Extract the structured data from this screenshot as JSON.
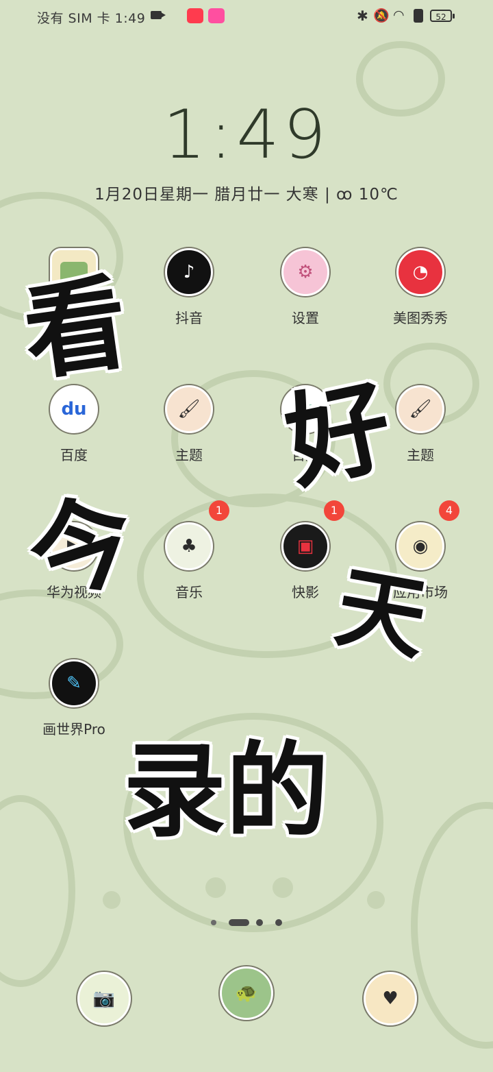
{
  "status_bar": {
    "carrier_time": "没有 SIM 卡 1:49",
    "battery_level": "52"
  },
  "lockscreen": {
    "time": "1:49",
    "date_line": "1月20日星期一  腊月廿一  大寒  |  ꝏ 10℃"
  },
  "apps": [
    {
      "label": "",
      "icon": "gallery-icon",
      "badge": ""
    },
    {
      "label": "抖音",
      "icon": "douyin-icon",
      "badge": ""
    },
    {
      "label": "设置",
      "icon": "settings-icon",
      "badge": ""
    },
    {
      "label": "美图秀秀",
      "icon": "meitu-icon",
      "badge": ""
    },
    {
      "label": "百度",
      "icon": "baidu-icon",
      "badge": ""
    },
    {
      "label": "主题",
      "icon": "theme-brush-icon",
      "badge": ""
    },
    {
      "label": "百度",
      "icon": "baidu-translate-icon",
      "badge": ""
    },
    {
      "label": "主题",
      "icon": "theme-brush-icon",
      "badge": ""
    },
    {
      "label": "华为视频",
      "icon": "video-icon",
      "badge": ""
    },
    {
      "label": "音乐",
      "icon": "music-icon",
      "badge": "1"
    },
    {
      "label": "快影",
      "icon": "kuaiying-icon",
      "badge": "1"
    },
    {
      "label": "应用市场",
      "icon": "app-market-icon",
      "badge": "4"
    },
    {
      "label": "画世界Pro",
      "icon": "painting-brush-icon",
      "badge": ""
    }
  ],
  "dock": [
    {
      "icon": "camera-frog-icon"
    },
    {
      "icon": "turtle-icon"
    },
    {
      "icon": "camera-heart-icon"
    }
  ],
  "overlay_text": {
    "c1": "看",
    "c2": "好",
    "c3": "今",
    "c4": "天",
    "c5": "录的"
  },
  "colors": {
    "wallpaper": "#d7e2c6",
    "badge": "#f2463a"
  }
}
